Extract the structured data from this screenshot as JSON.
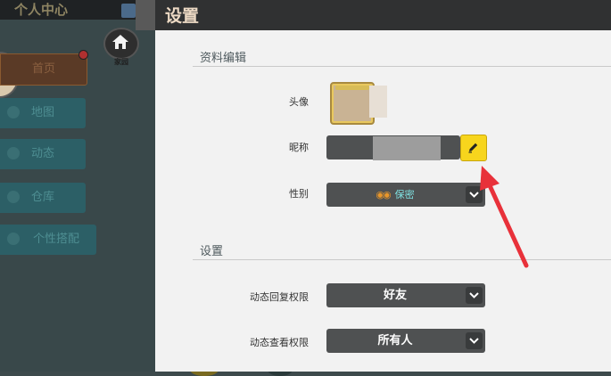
{
  "background": {
    "top_title": "个人中心",
    "home_label": "家园",
    "menu": [
      {
        "label": "首页"
      },
      {
        "label": "地图"
      },
      {
        "label": "动态"
      },
      {
        "label": "仓库"
      },
      {
        "label": "个性搭配"
      }
    ]
  },
  "settings": {
    "title": "设置",
    "profile_section": {
      "title": "资料编辑",
      "avatar_label": "头像",
      "nickname_label": "昵称",
      "nickname_value": "",
      "gender_label": "性别",
      "gender_value": "保密",
      "gender_icon": "mask-icon"
    },
    "settings_section": {
      "title": "设置",
      "reply_permission_label": "动态回复权限",
      "reply_permission_value": "好友",
      "view_permission_label": "动态查看权限",
      "view_permission_value": "所有人"
    }
  },
  "colors": {
    "accent_yellow": "#f7d51d",
    "annotation_arrow": "#e8313a",
    "gender_text": "#7fe0e0"
  }
}
